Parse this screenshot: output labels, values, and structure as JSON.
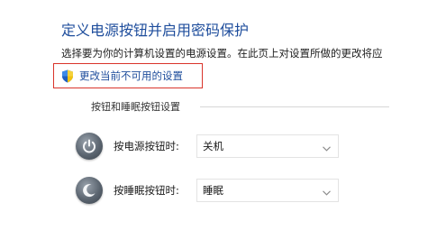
{
  "page": {
    "title": "定义电源按钮并启用密码保护",
    "subtitle": "选择要为你的计算机设置的电源设置。在此页上对设置所做的更改将应",
    "change_link": "更改当前不可用的设置"
  },
  "power_buttons_section": {
    "header": "按钮和睡眠按钮设置",
    "rows": [
      {
        "label": "按电源按钮时:",
        "selected_value": "关机",
        "icon": "power-icon"
      },
      {
        "label": "按睡眠按钮时:",
        "selected_value": "睡眠",
        "icon": "sleep-moon-icon"
      }
    ]
  },
  "colors": {
    "title_blue": "#1e4d9c",
    "highlight_red": "#d9342b"
  }
}
